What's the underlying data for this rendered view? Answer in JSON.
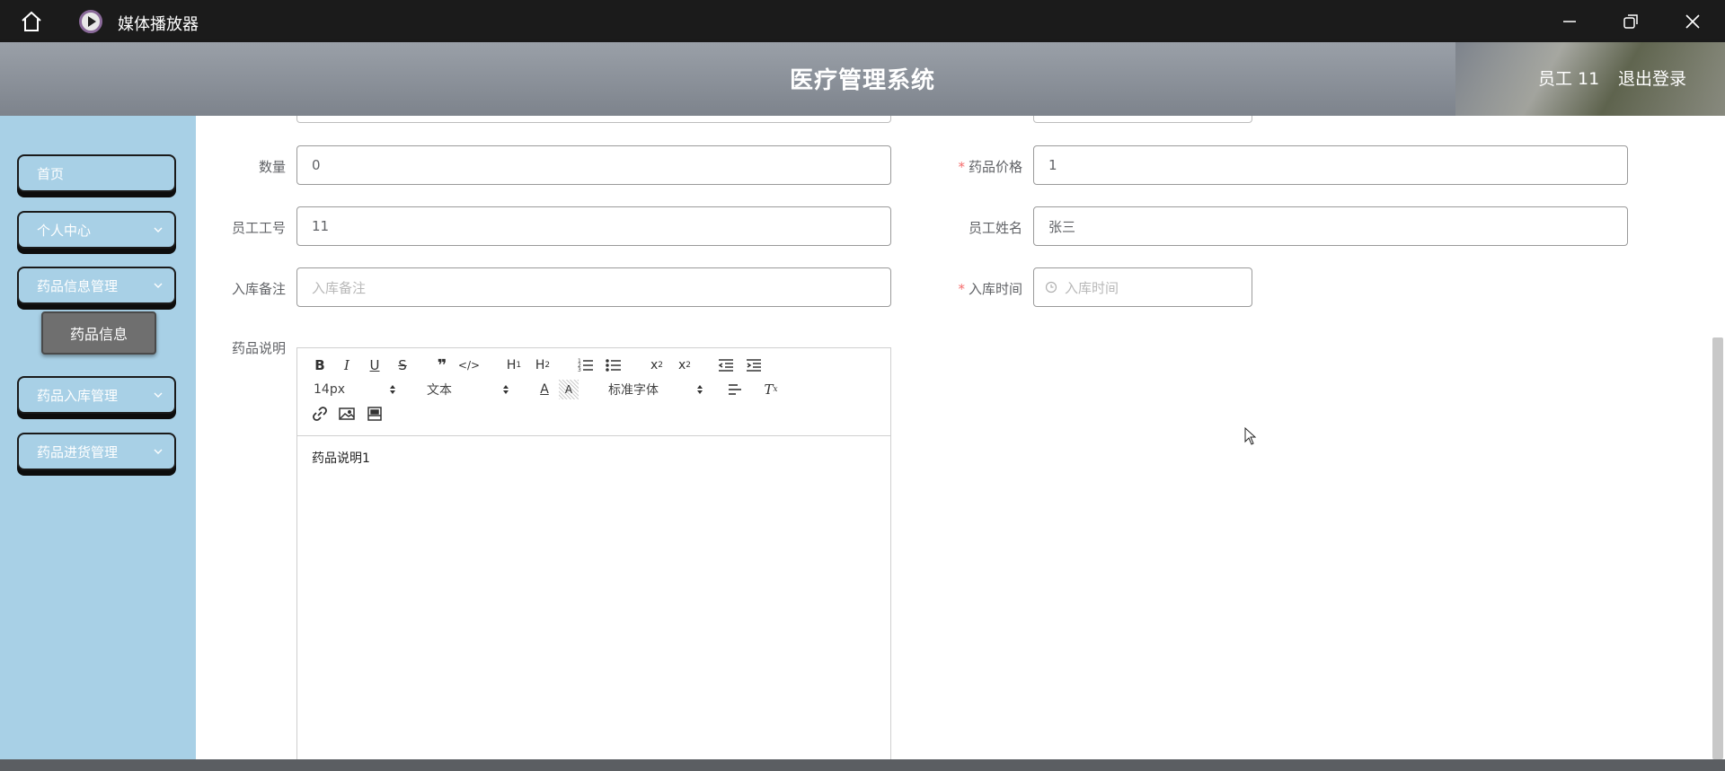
{
  "titlebar": {
    "app_title": "媒体播放器"
  },
  "header": {
    "title": "医疗管理系统",
    "user": "员工 11",
    "logout": "退出登录"
  },
  "sidebar": {
    "items": [
      {
        "label": "首页"
      },
      {
        "label": "个人中心"
      },
      {
        "label": "药品信息管理"
      },
      {
        "label": "药品入库管理"
      },
      {
        "label": "药品进货管理"
      }
    ],
    "sub_item": "药品信息"
  },
  "form": {
    "quantity_label": "数量",
    "quantity_value": "0",
    "price_label": "药品价格",
    "price_value": "1",
    "emp_id_label": "员工工号",
    "emp_id_value": "11",
    "emp_name_label": "员工姓名",
    "emp_name_value": "张三",
    "remark_label": "入库备注",
    "remark_placeholder": "入库备注",
    "time_label": "入库时间",
    "time_placeholder": "入库时间",
    "desc_label": "药品说明",
    "required_mark": "*"
  },
  "editor": {
    "font_size": "14px",
    "block_format": "文本",
    "font_family": "标准字体",
    "content": "药品说明1"
  },
  "colors": {
    "sidebar_bg": "#a8d0e6",
    "required": "#f56c6c",
    "submenu_bg": "#6f6f6f"
  }
}
